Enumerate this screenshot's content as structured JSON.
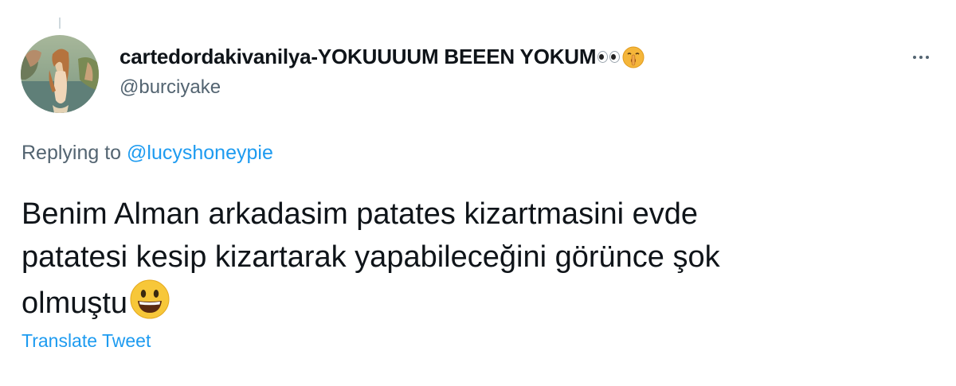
{
  "tweet": {
    "author": {
      "display_name": "cartedordakivanilya-YOKUUUUM BEEEN YOKUM",
      "name_emojis": [
        "eyes-icon",
        "shushing-face-icon"
      ],
      "handle": "@burciyake",
      "avatar": "birth-of-venus-avatar"
    },
    "reply": {
      "prefix": "Replying to",
      "mention": "@lucyshoneypie"
    },
    "text_lines": [
      "Benim Alman arkadasim patates kizartmasini evde",
      "patatesi kesip kizartarak yapabileceğini görünce şok",
      "olmuştu"
    ],
    "text_emoji": "grinning-face-icon",
    "translate_label": "Translate Tweet",
    "more_icon": "more-options-icon"
  },
  "colors": {
    "text": "#0f1419",
    "secondary": "#536471",
    "link": "#1d9bf0",
    "background": "#ffffff"
  }
}
